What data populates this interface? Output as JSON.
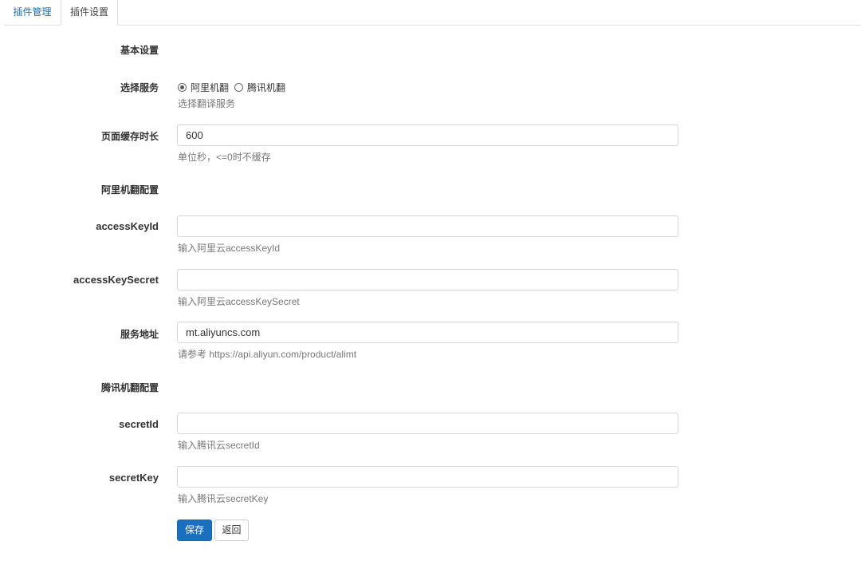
{
  "tabs": [
    {
      "label": "插件管理"
    },
    {
      "label": "插件设置"
    }
  ],
  "form": {
    "basic_section": "基本设置",
    "service": {
      "label": "选择服务",
      "options": [
        {
          "label": "阿里机翻",
          "checked": true
        },
        {
          "label": "腾讯机翻",
          "checked": false
        }
      ],
      "help": "选择翻译服务"
    },
    "cache": {
      "label": "页面缓存时长",
      "value": "600",
      "help": "单位秒，<=0时不缓存"
    },
    "ali_section": "阿里机翻配置",
    "access_key_id": {
      "label": "accessKeyId",
      "value": "",
      "help": "输入阿里云accessKeyId"
    },
    "access_key_secret": {
      "label": "accessKeySecret",
      "value": "",
      "help": "输入阿里云accessKeySecret"
    },
    "service_address": {
      "label": "服务地址",
      "value": "mt.aliyuncs.com",
      "help": "请参考 https://api.aliyun.com/product/alimt"
    },
    "tencent_section": "腾讯机翻配置",
    "secret_id": {
      "label": "secretId",
      "value": "",
      "help": "输入腾讯云secretId"
    },
    "secret_key": {
      "label": "secretKey",
      "value": "",
      "help": "输入腾讯云secretKey"
    }
  },
  "buttons": {
    "save_label": "保存",
    "back_label": "返回"
  },
  "colors": {
    "primary": "#1a6fc0",
    "link": "#1a6faf",
    "border": "#d6d6d6",
    "help_text": "#777777"
  }
}
